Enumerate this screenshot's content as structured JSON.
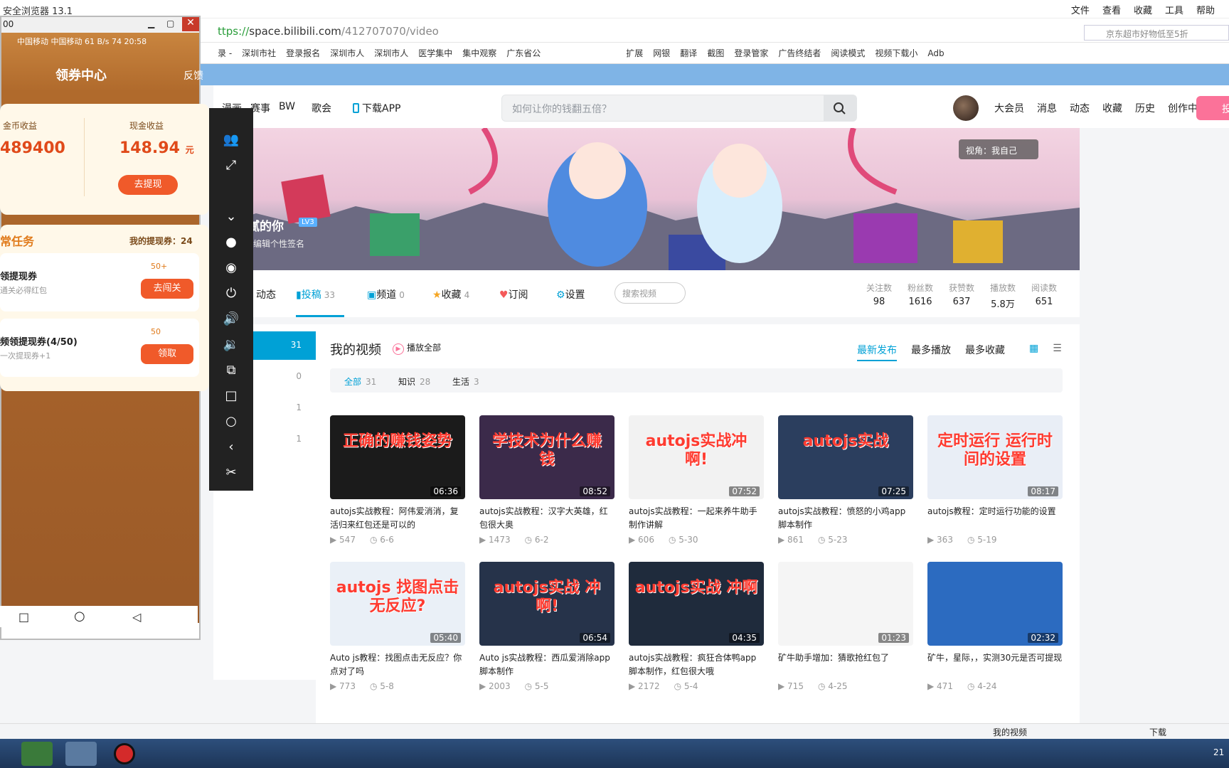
{
  "browser": {
    "title": "安全浏览器 13.1",
    "menu": [
      "文件",
      "查看",
      "收藏",
      "工具",
      "帮助"
    ],
    "url_prefix": "ttps://",
    "url_host": "space.bilibili.com",
    "url_path": "/412707070/video",
    "search_text": "京东超市好物低至5折",
    "favs": [
      "录 -",
      "深圳市社",
      "登录报名",
      "深圳市人",
      "深圳市人",
      "医学集中",
      "集中观察",
      "广东省公",
      "扩展",
      "网银",
      "翻译",
      "截图",
      "登录管家",
      "广告终结者",
      "阅读模式",
      "视频下载小",
      "Adb"
    ]
  },
  "phone": {
    "title_bar": "00",
    "status": "中国移动 中国移动 61 B/s 74 20:58",
    "title": "领券中心",
    "feedback": "反馈",
    "coin_label": "金币收益",
    "coin_value": "489400",
    "cash_label": "现金收益",
    "cash_value": "148.94",
    "cash_unit": "元",
    "withdraw": "去提现",
    "daily": "常任务",
    "ticket_label": "我的提现券：24",
    "task1": "领提现券",
    "task1_sub": "通关必得红包",
    "task1_bonus": "50+",
    "task1_btn": "去闯关",
    "task2": "频领提现券(4/50)",
    "task2_sub": "一次提现券+1",
    "task2_bonus": "50",
    "task2_btn": "领取"
  },
  "header": {
    "nav": [
      "漫画",
      "赛事",
      "BW",
      "歌会",
      "下载APP"
    ],
    "search_placeholder": "如何让你的钱翻五倍？",
    "links": [
      "大会员",
      "消息",
      "动态",
      "收藏",
      "历史",
      "创作中心"
    ],
    "upload": "投"
  },
  "banner": {
    "view": "视角：我自己",
    "user": "腻的你",
    "lvl": "LV3",
    "sign": "编辑个性签名"
  },
  "tabs": [
    {
      "label": "动态",
      "n": ""
    },
    {
      "label": "投稿",
      "n": "33"
    },
    {
      "label": "频道",
      "n": "0"
    },
    {
      "label": "收藏",
      "n": "4"
    },
    {
      "label": "订阅",
      "n": ""
    },
    {
      "label": "设置",
      "n": ""
    }
  ],
  "tab_search": "搜索视频",
  "stats": [
    {
      "l": "关注数",
      "v": "98"
    },
    {
      "l": "粉丝数",
      "v": "1616"
    },
    {
      "l": "获赞数",
      "v": "637"
    },
    {
      "l": "播放数",
      "v": "5.8万"
    },
    {
      "l": "阅读数",
      "v": "651"
    }
  ],
  "side": [
    "31",
    "0",
    "1",
    "1"
  ],
  "content": {
    "my_videos": "我的视频",
    "play_all": "播放全部",
    "sorts": [
      "最新发布",
      "最多播放",
      "最多收藏"
    ],
    "filters": [
      {
        "l": "全部",
        "n": "31"
      },
      {
        "l": "知识",
        "n": "28"
      },
      {
        "l": "生活",
        "n": "3"
      }
    ]
  },
  "videos": [
    {
      "tt": "正确的赚钱姿势",
      "dur": "06:36",
      "title": "autojs实战教程：阿伟爱消消，复活归来红包还是可以的",
      "plays": "547",
      "date": "6-6",
      "bg": "#1b1b1b"
    },
    {
      "tt": "学技术为什么赚钱",
      "dur": "08:52",
      "title": "autojs实战教程：汉字大英雄，红包很大奥",
      "plays": "1473",
      "date": "6-2",
      "bg": "#3b2a4a"
    },
    {
      "tt": "autojs实战冲啊!",
      "dur": "07:52",
      "title": "autojs实战教程：一起来养牛助手制作讲解",
      "plays": "606",
      "date": "5-30",
      "bg": "#f2f2f2"
    },
    {
      "tt": "autojs实战",
      "dur": "07:25",
      "title": "autojs实战教程：愤怒的小鸡app脚本制作",
      "plays": "861",
      "date": "5-23",
      "bg": "#2b3e5e"
    },
    {
      "tt": "定时运行 运行时间的设置",
      "dur": "08:17",
      "title": "autojs教程：定时运行功能的设置",
      "plays": "363",
      "date": "5-19",
      "bg": "#e9eef6"
    },
    {
      "tt": "autojs 找图点击无反应?",
      "dur": "05:40",
      "title": "Auto js教程：找图点击无反应？你点对了吗",
      "plays": "773",
      "date": "5-8",
      "bg": "#eaf0f7"
    },
    {
      "tt": "autojs实战 冲啊!",
      "dur": "06:54",
      "title": "Auto js实战教程：西瓜爱消除app脚本制作",
      "plays": "2003",
      "date": "5-5",
      "bg": "#26334a"
    },
    {
      "tt": "autojs实战 冲啊",
      "dur": "04:35",
      "title": "autojs实战教程：疯狂合体鸭app脚本制作，红包很大哦",
      "plays": "2172",
      "date": "5-4",
      "bg": "#1f2b3c"
    },
    {
      "tt": "",
      "dur": "01:23",
      "title": "矿牛助手增加：猜歌抢红包了",
      "plays": "715",
      "date": "4-25",
      "bg": "#f5f5f5"
    },
    {
      "tt": "",
      "dur": "02:32",
      "title": "矿牛，星际，，实测30元是否可提现",
      "plays": "471",
      "date": "4-24",
      "bg": "#2c6bc0"
    }
  ],
  "statusbar": {
    "label": "我的视频",
    "download": "下载"
  },
  "taskbar": {
    "clock": "21"
  },
  "colors": {
    "accent": "#00a1d6",
    "pink": "#fb7299",
    "orange": "#ff6a1f"
  }
}
